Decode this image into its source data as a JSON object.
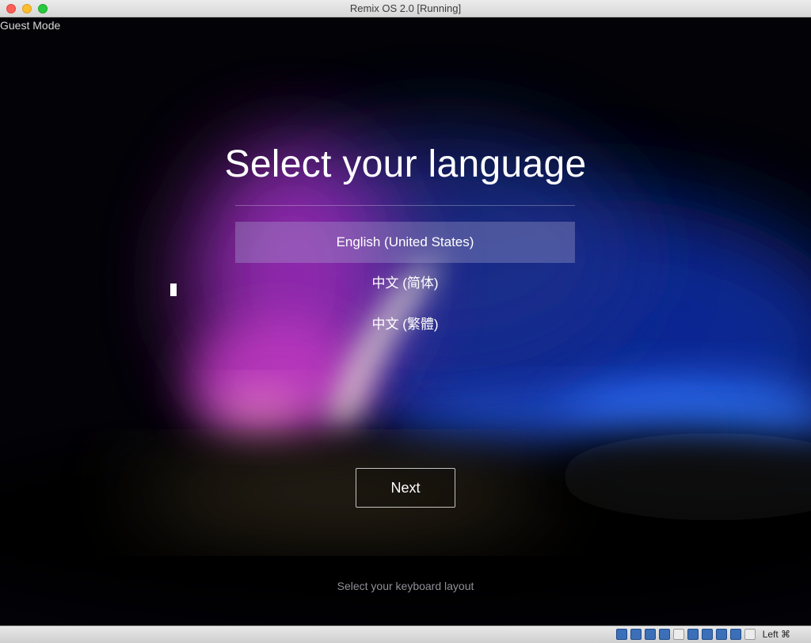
{
  "window": {
    "title": "Remix OS 2.0 [Running]"
  },
  "vm": {
    "guest_mode": "Guest Mode",
    "heading": "Select your language",
    "languages": [
      {
        "label": "English (United States)",
        "selected": true
      },
      {
        "label": "中文 (简体)",
        "selected": false
      },
      {
        "label": "中文 (繁體)",
        "selected": false
      }
    ],
    "next_label": "Next",
    "keyboard_link": "Select your keyboard layout"
  },
  "statusbar": {
    "icons": [
      "cd-icon",
      "network-icon",
      "usb-icon",
      "pen-icon",
      "shared-folder-icon",
      "display-icon",
      "capture-icon",
      "video-icon",
      "mouse-icon",
      "download-icon"
    ],
    "host_key": "Left ⌘"
  },
  "colors": {
    "accent": "#aaa5d2",
    "text": "#ffffff",
    "link": "#8f8f96"
  }
}
